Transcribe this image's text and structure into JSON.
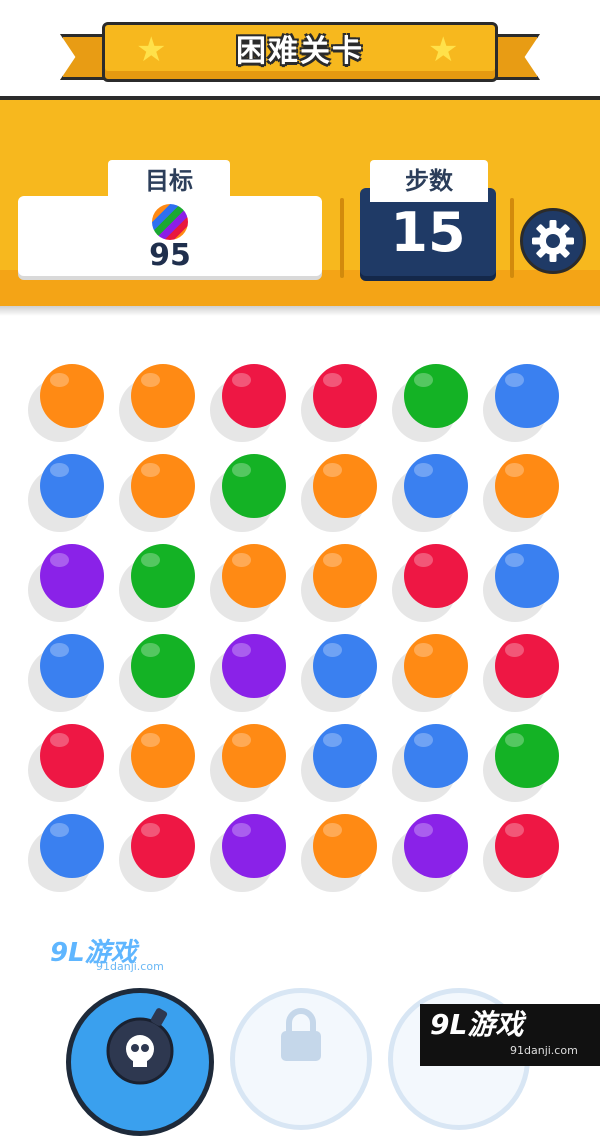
{
  "banner": {
    "title": "困难关卡"
  },
  "goal": {
    "label": "目标",
    "count": "95",
    "ball_icon": "rainbow-ball-icon"
  },
  "moves": {
    "label": "步数",
    "count": "15"
  },
  "settings": {
    "icon": "gear-icon"
  },
  "colors": {
    "orange": "#ff8a14",
    "red": "#ee1744",
    "green": "#14b225",
    "blue": "#3a80f0",
    "purple": "#8a22e8",
    "header": "#f7b81e",
    "navy": "#1f3a66"
  },
  "board": {
    "rows": [
      [
        "orange",
        "orange",
        "red",
        "red",
        "green",
        "blue"
      ],
      [
        "blue",
        "orange",
        "green",
        "orange",
        "blue",
        "orange"
      ],
      [
        "purple",
        "green",
        "orange",
        "orange",
        "red",
        "blue"
      ],
      [
        "blue",
        "green",
        "purple",
        "blue",
        "orange",
        "red"
      ],
      [
        "red",
        "orange",
        "orange",
        "blue",
        "blue",
        "green"
      ],
      [
        "blue",
        "red",
        "purple",
        "orange",
        "purple",
        "red"
      ]
    ]
  },
  "watermark": {
    "brand": "9L游戏",
    "url": "91danji.com"
  },
  "boosters": [
    {
      "icon": "bomb-skull-icon",
      "state": "unlocked"
    },
    {
      "icon": "lock-icon",
      "state": "locked"
    },
    {
      "icon": "lock-icon",
      "state": "locked"
    }
  ]
}
